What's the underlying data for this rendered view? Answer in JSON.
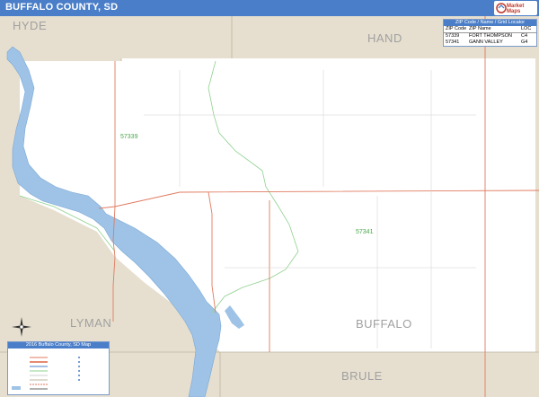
{
  "title": "BUFFALO COUNTY, SD",
  "logo": {
    "text": "Market Maps"
  },
  "counties": {
    "hyde": "HYDE",
    "hand": "HAND",
    "lyman": "LYMAN",
    "buffalo": "BUFFALO",
    "brule": "BRULE"
  },
  "zip_labels": {
    "z57339": "57339",
    "z57341": "57341"
  },
  "zip_table": {
    "title": "ZIP Code / Name / Grid Locator",
    "headers": {
      "code": "ZIP Code",
      "name": "ZIP Name",
      "loc": "LOC"
    },
    "rows": [
      {
        "code": "57339",
        "name": "FORT THOMPSON",
        "loc": "C4"
      },
      {
        "code": "57341",
        "name": "GANN VALLEY",
        "loc": "G4"
      }
    ]
  },
  "legend": {
    "title": "2016 Buffalo County, SD Map"
  },
  "colors": {
    "title_bar": "#4a7ec8",
    "outside_county": "#e6dfcf",
    "water": "#9ec3e6",
    "road": "#e07a5f",
    "zip_boundary": "#8fd18f"
  }
}
